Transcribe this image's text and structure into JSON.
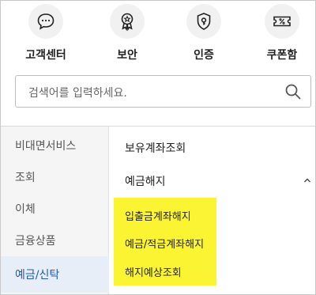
{
  "quick_menu": [
    {
      "label": "고객센터",
      "icon": "chat-bubble-icon"
    },
    {
      "label": "보안",
      "icon": "security-badge-icon"
    },
    {
      "label": "인증",
      "icon": "certificate-shield-icon"
    },
    {
      "label": "쿠폰함",
      "icon": "coupon-icon"
    }
  ],
  "search": {
    "placeholder": "검색어를 입력하세요."
  },
  "sidebar": {
    "items": [
      {
        "label": "비대면서비스"
      },
      {
        "label": "조회"
      },
      {
        "label": "이체"
      },
      {
        "label": "금융상품"
      },
      {
        "label": "예금/신탁",
        "active": true
      }
    ]
  },
  "submenu": {
    "items": [
      {
        "label": "보유계좌조회"
      },
      {
        "label": "예금해지",
        "expanded": true
      }
    ],
    "expanded_children": [
      {
        "label": "입출금계좌해지"
      },
      {
        "label": "예금/적금계좌해지"
      },
      {
        "label": "해지예상조회"
      }
    ]
  },
  "colors": {
    "highlight": "#fbf433",
    "active_text": "#2458b3",
    "sidebar_bg": "#f5f5f5"
  }
}
